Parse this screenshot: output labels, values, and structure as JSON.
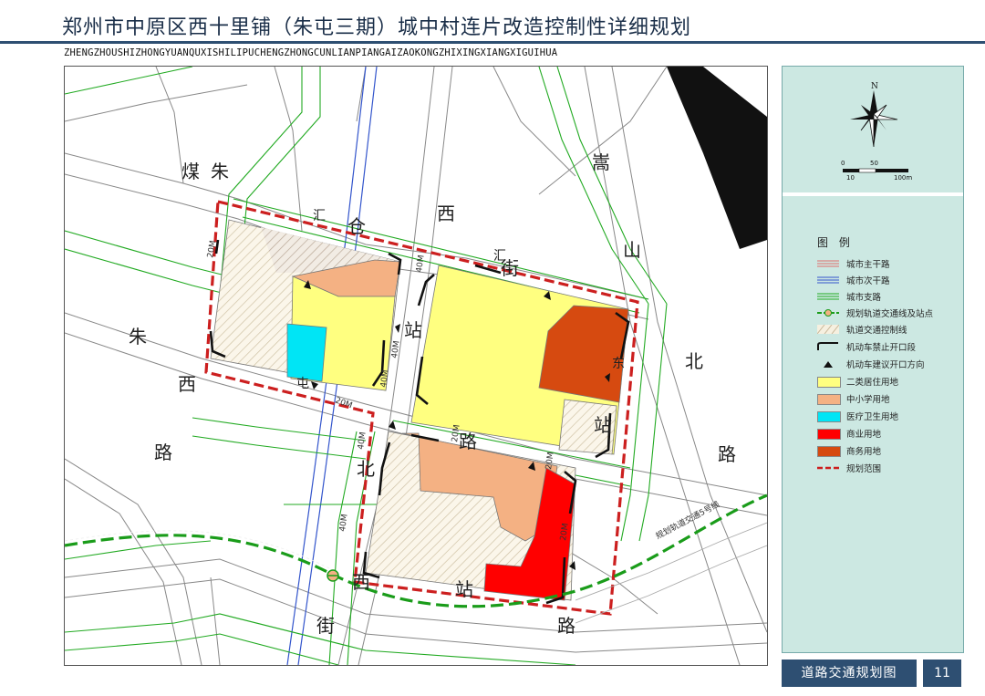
{
  "header": {
    "title": "郑州市中原区西十里铺（朱屯三期）城中村连片改造控制性详细规划",
    "subtitle": "ZHENGZHOUSHIZHONGYUANQUXISHILIPUCHENGZHONGCUNLIANPIANGAIZAOKONGZHIXINGXIANGXIGUIHUA"
  },
  "map": {
    "labels": {
      "mei": "煤",
      "zhu1": "朱",
      "zhu2": "朱",
      "cang": "仓",
      "xi1": "西",
      "jie1": "街",
      "song": "嵩",
      "shan": "山",
      "bei1": "北",
      "lu1": "路",
      "xi2": "西",
      "lu2": "路",
      "zhan1": "站",
      "zhan2": "站",
      "lu3": "路",
      "bei2": "北",
      "xi3": "西",
      "jie2": "街",
      "zhan3": "站",
      "lu4": "路",
      "hui1": "汇",
      "hui2": "汇",
      "tun": "屯",
      "dong": "东"
    },
    "widths": {
      "w1": "20M",
      "w2": "40M",
      "w3": "40M",
      "w4": "40M",
      "w5": "20M",
      "w6": "40M",
      "w7": "20M",
      "w8": "40M",
      "w9": "20M",
      "w10": "20M"
    },
    "rail_label": "规划轨道交通5号线"
  },
  "compass": {
    "north": "N",
    "scale_0": "0",
    "scale_50": "50",
    "scale_10": "10",
    "scale_100": "100m"
  },
  "legend": {
    "title": "图 例",
    "items": [
      {
        "label": "城市主干路",
        "kind": "main-road"
      },
      {
        "label": "城市次干路",
        "kind": "secondary-road"
      },
      {
        "label": "城市支路",
        "kind": "branch-road"
      },
      {
        "label": "规划轨道交通线及站点",
        "kind": "rail"
      },
      {
        "label": "轨道交通控制线",
        "kind": "rail-control"
      },
      {
        "label": "机动车禁止开口段",
        "kind": "no-opening"
      },
      {
        "label": "机动车建议开口方向",
        "kind": "opening-direction"
      },
      {
        "label": "二类居住用地",
        "kind": "residential",
        "color": "#ffff80"
      },
      {
        "label": "中小学用地",
        "kind": "school",
        "color": "#f4b183"
      },
      {
        "label": "医疗卫生用地",
        "kind": "medical",
        "color": "#00e5f5"
      },
      {
        "label": "商业用地",
        "kind": "commercial",
        "color": "#ff0000"
      },
      {
        "label": "商务用地",
        "kind": "business",
        "color": "#d64a10"
      },
      {
        "label": "规划范围",
        "kind": "boundary",
        "color": "#cc1f1f"
      }
    ]
  },
  "footer": {
    "title": "道路交通规划图",
    "page": "11"
  },
  "colors": {
    "header": "#2e4f72",
    "panel": "#cce8e2",
    "main_road": "#e06b6b",
    "secondary_road": "#3355cc",
    "branch_road": "#22aa22",
    "residential": "#ffff80",
    "school": "#f4b183",
    "medical": "#00e5f5",
    "commercial": "#ff0000",
    "business": "#d64a10",
    "boundary": "#cc1f1f"
  }
}
